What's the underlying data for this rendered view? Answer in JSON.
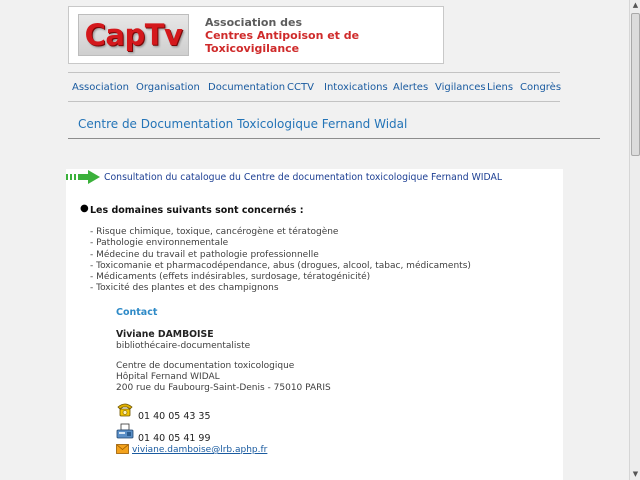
{
  "header": {
    "logo_text": "CapTv",
    "assoc_line1": "Association des",
    "assoc_line2": "Centres Antipoison et de Toxicovigilance"
  },
  "nav": {
    "items": [
      "Association",
      "Organisation",
      "Documentation",
      "CCTV",
      "Intoxications",
      "Alertes",
      "Vigilances",
      "Liens",
      "Congrès"
    ]
  },
  "page_title": "Centre de Documentation Toxicologique Fernand Widal",
  "content": {
    "consult_title": "Consultation du catalogue du Centre de documentation toxicologique Fernand WIDAL",
    "domains_heading": "Les domaines suivants sont concernés :",
    "domains": [
      "- Risque chimique, toxique, cancérogène et tératogène",
      "- Pathologie environnementale",
      "- Médecine du travail et pathologie professionnelle",
      "- Toxicomanie et pharmacodépendance, abus (drogues, alcool, tabac, médicaments)",
      "- Médicaments (effets indésirables, surdosage, tératogénicité)",
      "- Toxicité des plantes et des champignons"
    ],
    "contact": {
      "heading": "Contact",
      "name": "Viviane DAMBOISE",
      "role": "bibliothécaire-documentaliste",
      "address_1": "Centre de documentation toxicologique",
      "address_2": "Hôpital Fernand WIDAL",
      "address_3": "200 rue du Faubourg-Saint-Denis - 75010 PARIS",
      "phone": "01 40 05 43 35",
      "fax": "01 40 05 41 99",
      "email": "viviane.damboise@lrb.aphp.fr"
    }
  },
  "colors": {
    "link": "#1a5ba0",
    "title": "#2474b7",
    "logo_red": "#d4181c",
    "arrow_green": "#3bb13b"
  },
  "icons": [
    "green-arrow-icon",
    "bullet-icon",
    "telephone-icon",
    "fax-icon",
    "mail-icon"
  ]
}
